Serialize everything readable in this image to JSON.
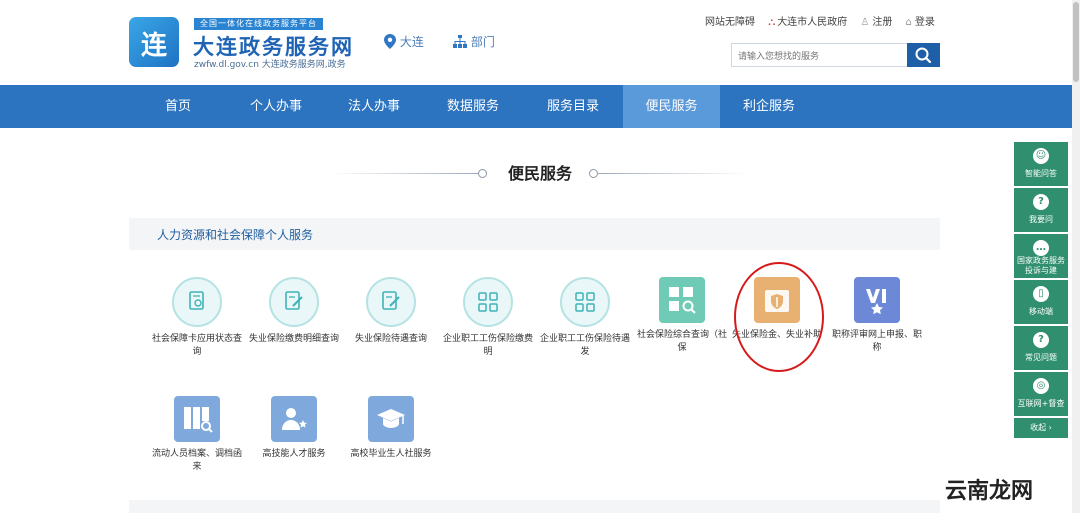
{
  "logo": {
    "mark": "连",
    "tag": "全国一体化在线政务服务平台",
    "title": "大连政务服务网",
    "domain": "zwfw.dl.gov.cn  大连政务服务网,政务"
  },
  "header": {
    "location": "大连",
    "dept": "部门",
    "links": [
      "网站无障碍",
      "大连市人民政府",
      "注册",
      "登录"
    ],
    "search_placeholder": "请输入您想找的服务"
  },
  "nav": [
    "首页",
    "个人办事",
    "法人办事",
    "数据服务",
    "服务目录",
    "便民服务",
    "利企服务"
  ],
  "nav_active": "便民服务",
  "section_title": "便民服务",
  "category": "人力资源和社会保障个人服务",
  "services_row1": [
    {
      "label": "社会保障卡应用状态查询",
      "icon": "document-search-icon"
    },
    {
      "label": "失业保险缴费明细查询",
      "icon": "document-edit-icon"
    },
    {
      "label": "失业保险待遇查询",
      "icon": "document-edit-icon"
    },
    {
      "label": "企业职工工伤保险缴费明",
      "icon": "grid-icon"
    },
    {
      "label": "企业职工工伤保险待遇发",
      "icon": "grid-icon"
    },
    {
      "label": "社会保险综合查询（社保",
      "icon": "grid-search-icon"
    },
    {
      "label": "失业保险金、失业补助",
      "icon": "shield-icon"
    },
    {
      "label": "职称评审网上申报、职称",
      "icon": "badge-icon"
    }
  ],
  "services_row2": [
    {
      "label": "流动人员档案、调档函来",
      "icon": "archive-icon"
    },
    {
      "label": "高技能人才服务",
      "icon": "person-star-icon"
    },
    {
      "label": "高校毕业生人社服务",
      "icon": "graduation-cap-icon"
    }
  ],
  "sidebar": [
    "智能问答",
    "我要问",
    "国家政务服务投诉与建",
    "移动端",
    "常见问题",
    "互联网+督查"
  ],
  "sidebar_fold": "收起",
  "watermark": "云南龙网",
  "colors": {
    "nav": "#2c73c0",
    "nav_active": "#5a99da",
    "side": "#2f8f6e",
    "accent": "#1f5fa8"
  }
}
